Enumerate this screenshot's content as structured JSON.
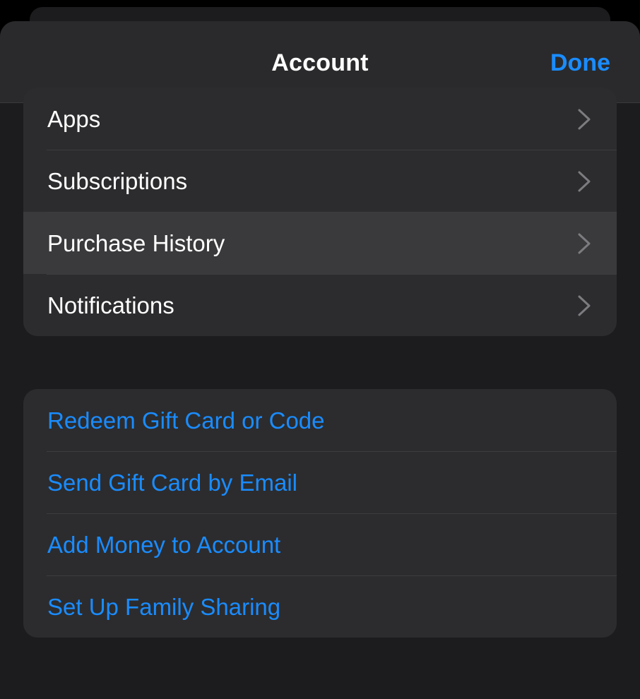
{
  "header": {
    "title": "Account",
    "done_label": "Done"
  },
  "account_group": {
    "items": [
      {
        "label": "Apps",
        "icon": "chevron-right-icon"
      },
      {
        "label": "Subscriptions",
        "icon": "chevron-right-icon"
      },
      {
        "label": "Purchase History",
        "icon": "chevron-right-icon"
      },
      {
        "label": "Notifications",
        "icon": "chevron-right-icon"
      }
    ]
  },
  "actions_group": {
    "items": [
      {
        "label": "Redeem Gift Card or Code"
      },
      {
        "label": "Send Gift Card by Email"
      },
      {
        "label": "Add Money to Account"
      },
      {
        "label": "Set Up Family Sharing"
      }
    ]
  },
  "colors": {
    "accent": "#1a8cff",
    "background": "#1c1c1e",
    "cell": "#2c2c2e",
    "highlight": "#3a3a3c"
  }
}
